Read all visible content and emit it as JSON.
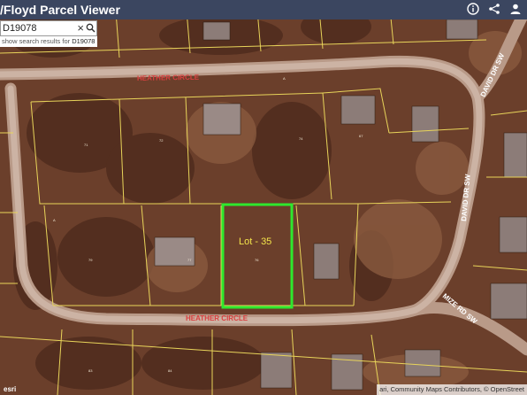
{
  "app": {
    "title": "/Floyd Parcel Viewer"
  },
  "search": {
    "value": "D19078",
    "suggestion_prefix": "show search results for ",
    "suggestion_term": "D19078"
  },
  "map": {
    "streets": {
      "heather_circle_top": "HEATHER CIRCLE",
      "heather_circle_bottom": "HEATHER CIRCLE",
      "david_dr_upper": "DAVID DR SW",
      "david_dr_lower": "DAVID DR SW",
      "mize_rd": "MIZE RD SW"
    },
    "highlight_label": "Lot - 35",
    "highlight_color": "#2ee82e",
    "parcel_line_color": "#f1e36a",
    "road_color": "#c9b3a6"
  },
  "attribution": {
    "text": "ari, Community Maps Contributors, © OpenStreet",
    "logo": "esri"
  }
}
